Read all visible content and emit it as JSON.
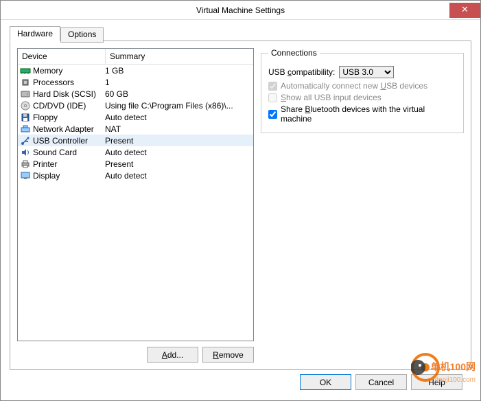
{
  "window": {
    "title": "Virtual Machine Settings"
  },
  "tabs": {
    "hardware": "Hardware",
    "options": "Options"
  },
  "columns": {
    "device": "Device",
    "summary": "Summary"
  },
  "devices": [
    {
      "icon": "memory-icon",
      "name": "Memory",
      "summary": "1 GB"
    },
    {
      "icon": "cpu-icon",
      "name": "Processors",
      "summary": "1"
    },
    {
      "icon": "hdd-icon",
      "name": "Hard Disk (SCSI)",
      "summary": "60 GB"
    },
    {
      "icon": "cd-icon",
      "name": "CD/DVD (IDE)",
      "summary": "Using file C:\\Program Files (x86)\\..."
    },
    {
      "icon": "floppy-icon",
      "name": "Floppy",
      "summary": "Auto detect"
    },
    {
      "icon": "net-icon",
      "name": "Network Adapter",
      "summary": "NAT"
    },
    {
      "icon": "usb-icon",
      "name": "USB Controller",
      "summary": "Present"
    },
    {
      "icon": "sound-icon",
      "name": "Sound Card",
      "summary": "Auto detect"
    },
    {
      "icon": "printer-icon",
      "name": "Printer",
      "summary": "Present"
    },
    {
      "icon": "display-icon",
      "name": "Display",
      "summary": "Auto detect"
    }
  ],
  "selected_device_index": 6,
  "buttons": {
    "add": "Add...",
    "remove": "Remove",
    "ok": "OK",
    "cancel": "Cancel",
    "help": "Help"
  },
  "connections": {
    "legend": "Connections",
    "compat_label": "USB compatibility:",
    "compat_value": "USB 3.0",
    "auto_connect": "Automatically connect new USB devices",
    "show_all": "Show all USB input devices",
    "share_bt": "Share Bluetooth devices with the virtual machine"
  },
  "watermark": {
    "line1": "单机100网",
    "line2": "danji100.com"
  }
}
